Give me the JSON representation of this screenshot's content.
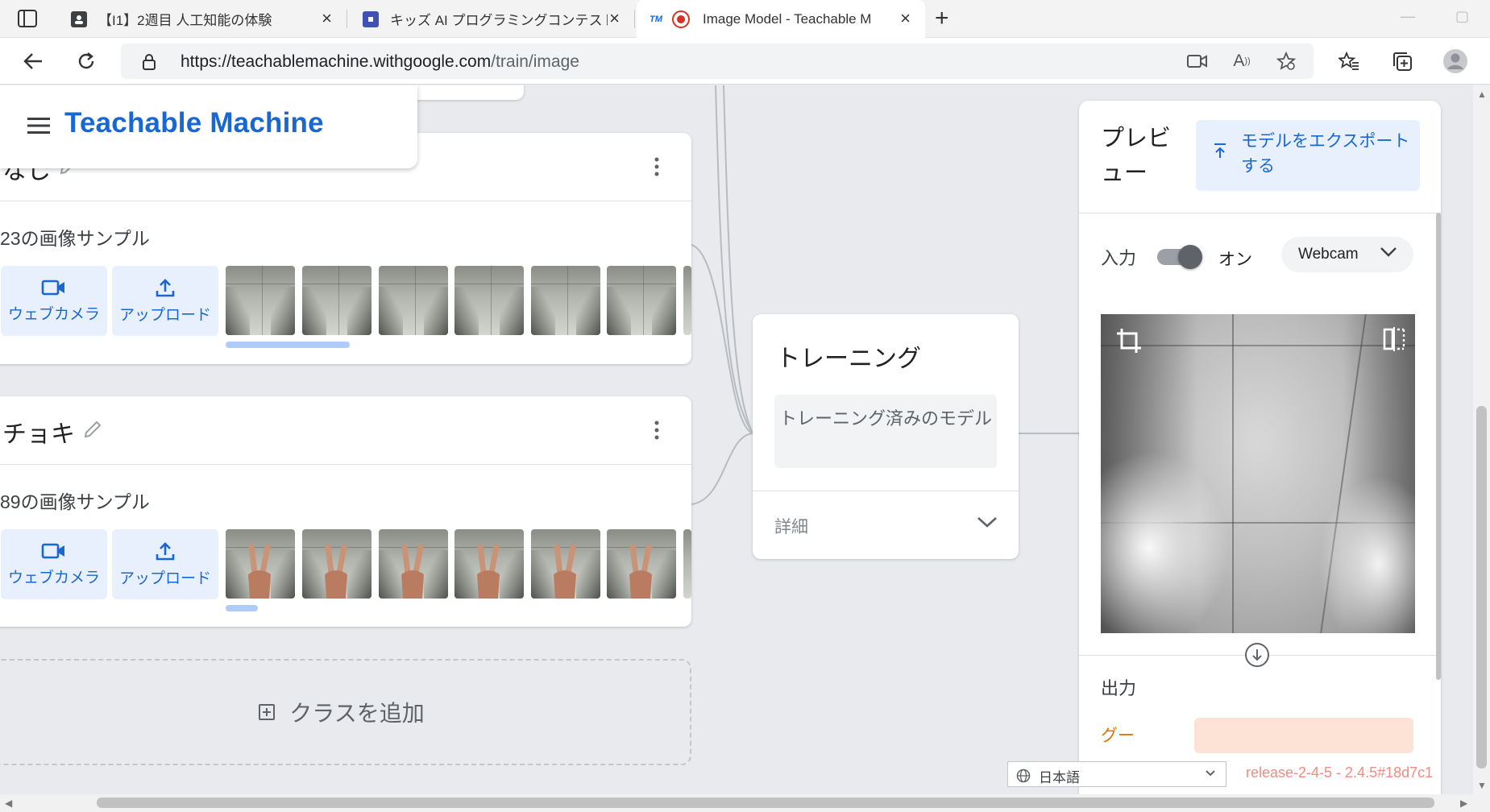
{
  "browser": {
    "tabs": [
      {
        "title": "【I1】2週目 人工知能の体験",
        "favicon": "person"
      },
      {
        "title": "キッズ AI プログラミングコンテスト",
        "favicon": "square"
      },
      {
        "title": "Image Model - Teachable M",
        "favicon": "TM"
      }
    ],
    "active_tab": 2,
    "url_host": "https://teachablemachine.withgoogle.com",
    "url_path": "/train/image",
    "new_tab_label": "+"
  },
  "app": {
    "brand": "Teachable Machine"
  },
  "classes": [
    {
      "name": "なし",
      "sample_count": "23の画像サンプル",
      "webcam_label": "ウェブカメラ",
      "upload_label": "アップロード",
      "thumb_type": "ceiling"
    },
    {
      "name": "チョキ",
      "sample_count": "89の画像サンプル",
      "webcam_label": "ウェブカメラ",
      "upload_label": "アップロード",
      "thumb_type": "peace"
    }
  ],
  "add_class_label": "クラスを追加",
  "training": {
    "title": "トレーニング",
    "button_label": "トレーニング済みのモデル",
    "advanced_label": "詳細"
  },
  "preview": {
    "title": "プレビュー",
    "export_label": "モデルをエクスポートする",
    "input_label": "入力",
    "toggle_state": "オン",
    "source_select": "Webcam",
    "output_label": "出力",
    "output_class": "グー",
    "output_class_color": "#e37400",
    "output_bar_color": "#fde2d6"
  },
  "footer": {
    "language": "日本語",
    "release": "release-2-4-5 - 2.4.5#18d7c1"
  },
  "colors": {
    "brand_blue": "#1967d2",
    "button_bg": "#e8f0fe",
    "page_bg": "#e8eaed"
  }
}
